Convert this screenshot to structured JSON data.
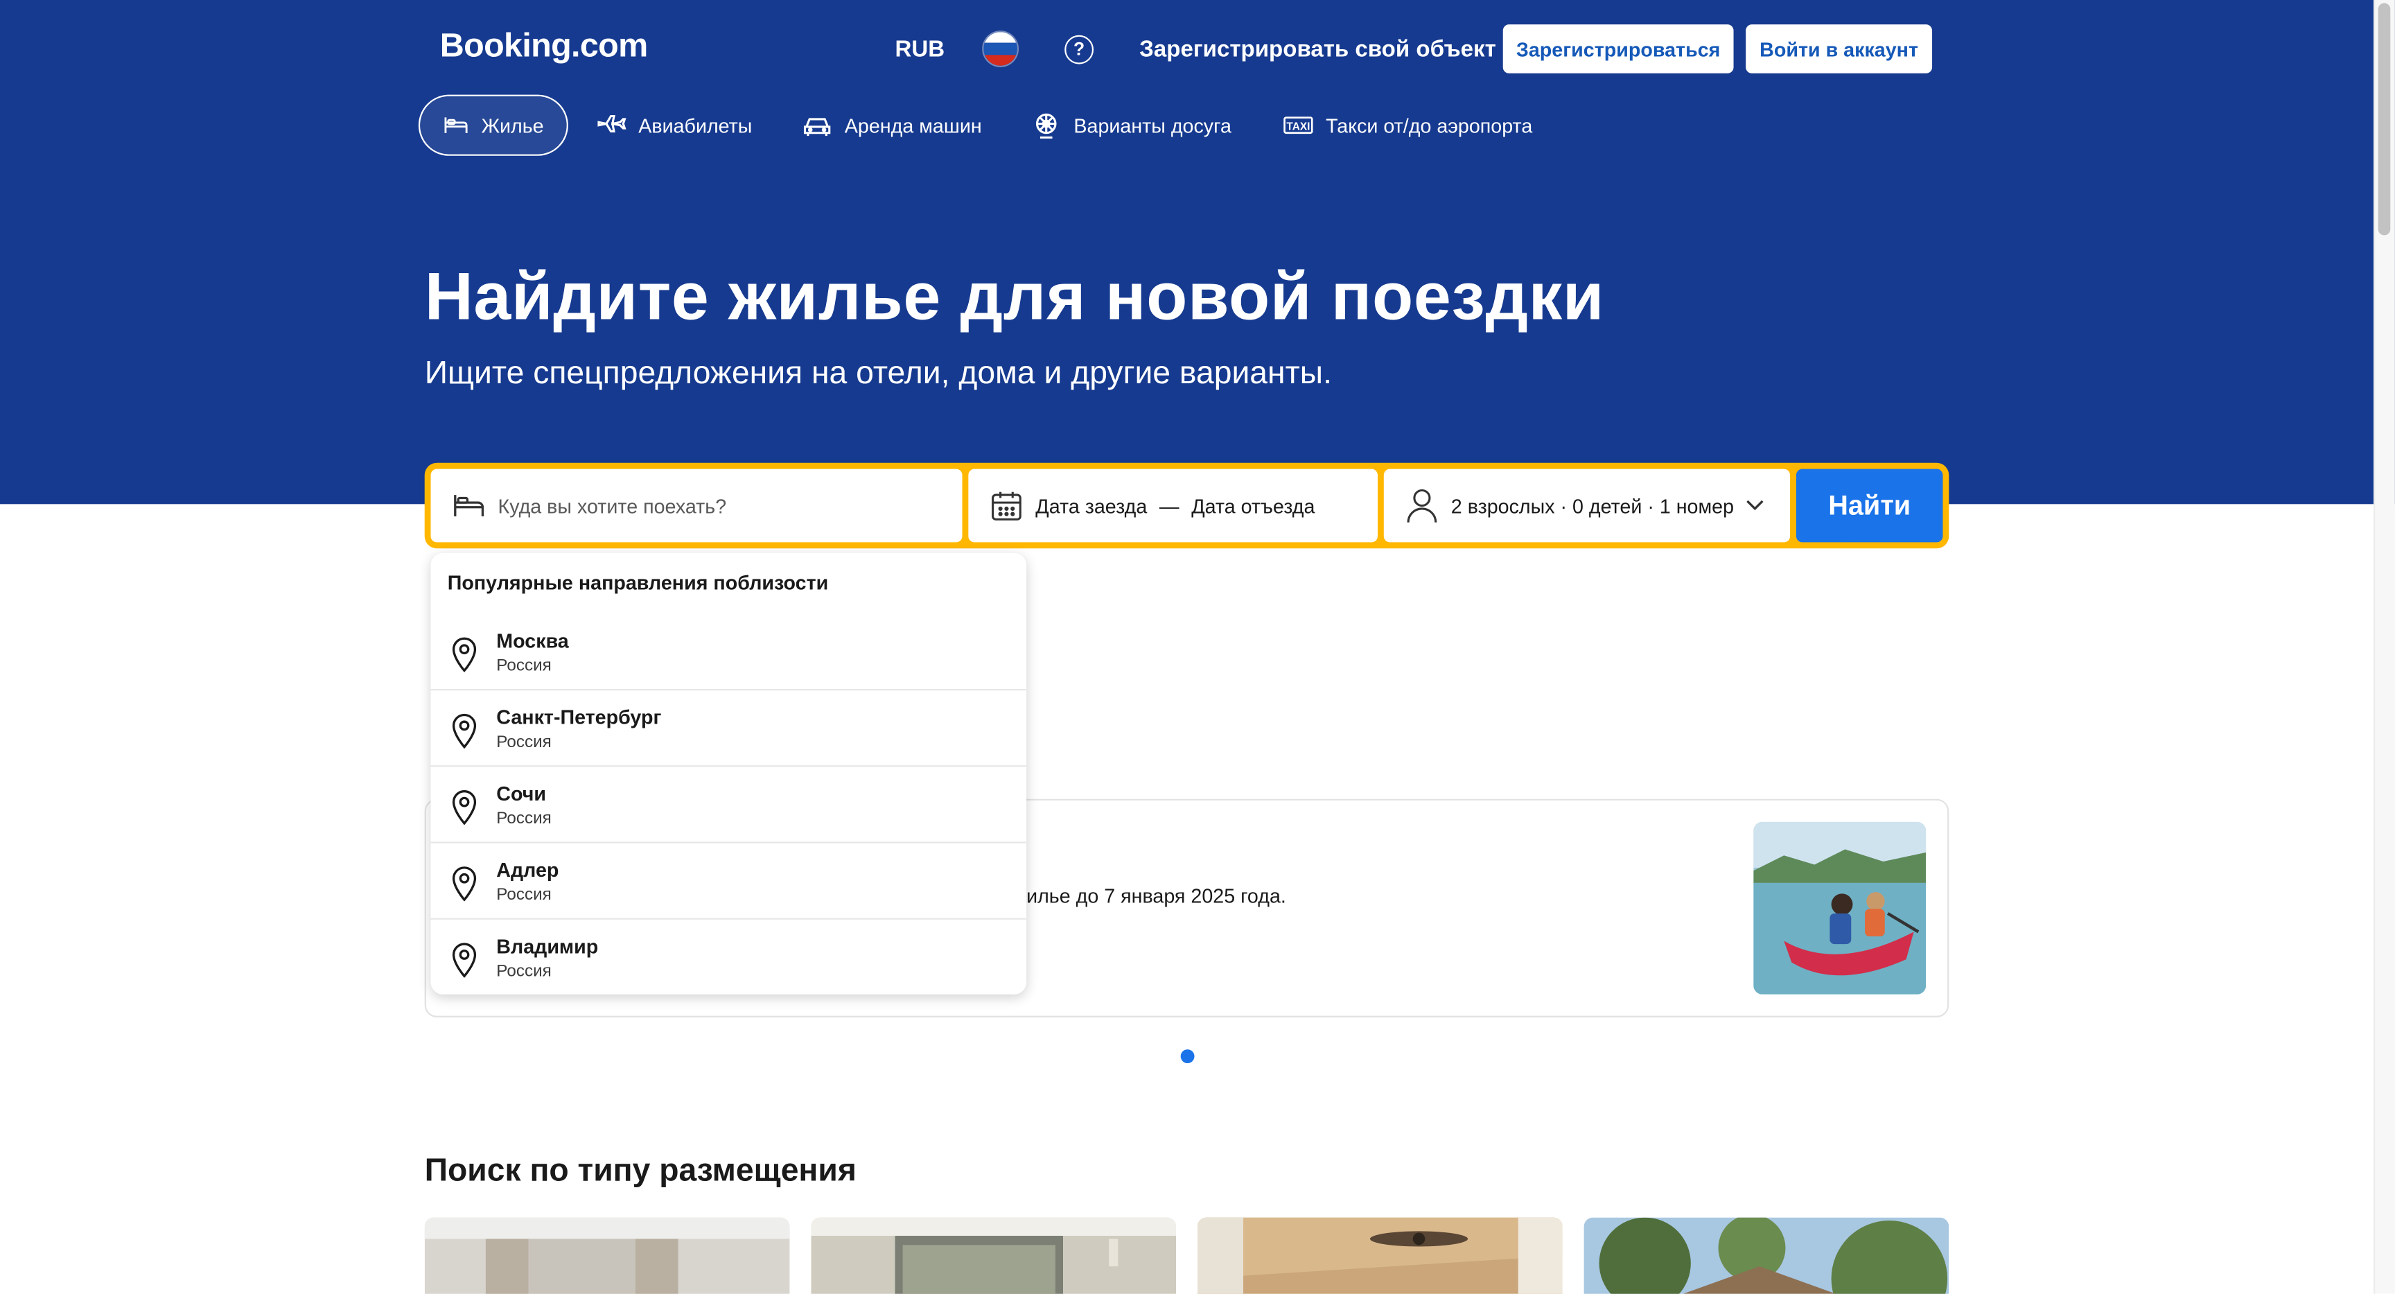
{
  "header": {
    "logo": "Booking.com",
    "currency": "RUB",
    "list_property": "Зарегистрировать свой объект",
    "register_button": "Зарегистрироваться",
    "signin_button": "Войти в аккаунт"
  },
  "nav": {
    "tabs": [
      {
        "label": "Жилье",
        "icon": "bed-icon",
        "active": true
      },
      {
        "label": "Авиабилеты",
        "icon": "plane-icon"
      },
      {
        "label": "Аренда машин",
        "icon": "car-icon"
      },
      {
        "label": "Варианты досуга",
        "icon": "attractions-icon"
      },
      {
        "label": "Такси от/до аэропорта",
        "icon": "taxi-icon"
      }
    ]
  },
  "hero": {
    "title": "Найдите жилье для новой поездки",
    "subtitle": "Ищите спецпредложения на отели, дома и другие варианты."
  },
  "search": {
    "destination_placeholder": "Куда вы хотите поехать?",
    "checkin": "Дата заезда",
    "dash": "—",
    "checkout": "Дата отъезда",
    "guests": "2 взрослых · 0 детей · 1 номер",
    "submit": "Найти"
  },
  "dropdown": {
    "heading": "Популярные направления поблизости",
    "items": [
      {
        "city": "Москва",
        "country": "Россия"
      },
      {
        "city": "Санкт-Петербург",
        "country": "Россия"
      },
      {
        "city": "Сочи",
        "country": "Россия"
      },
      {
        "city": "Адлер",
        "country": "Россия"
      },
      {
        "city": "Владимир",
        "country": "Россия"
      }
    ]
  },
  "promo": {
    "text_visible": "илье до 7 января 2025 года."
  },
  "property_types": {
    "title": "Поиск по типу размещения"
  },
  "colors": {
    "brand_blue": "#163a8f",
    "accent_yellow": "#ffb700",
    "button_blue": "#1a73e8",
    "link_blue": "#1559b8"
  }
}
